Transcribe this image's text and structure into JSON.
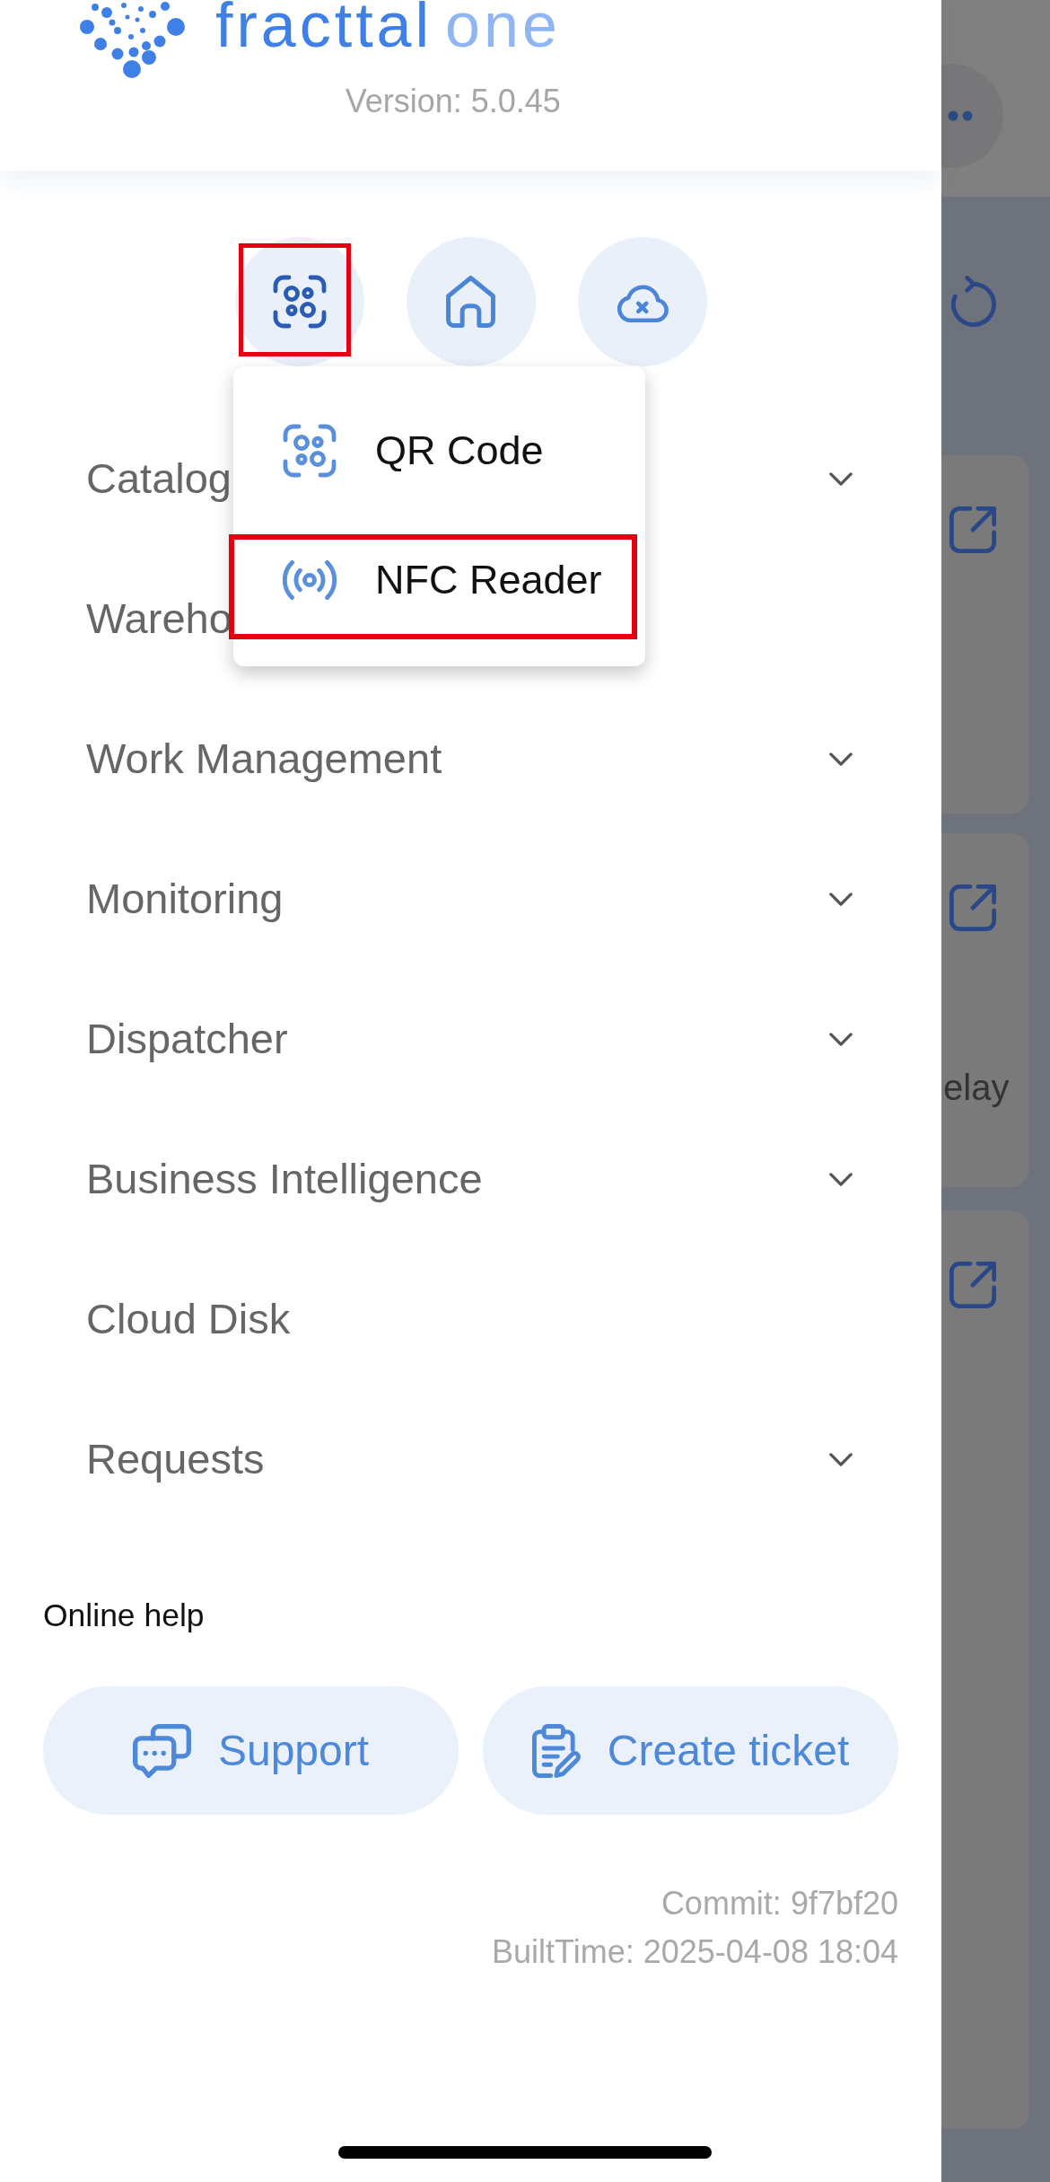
{
  "logo": {
    "name": "fracttal",
    "suffix": "one"
  },
  "version": "Version: 5.0.45",
  "quick_actions": [
    {
      "kind": "scan",
      "selected": true,
      "highlighted": true
    },
    {
      "kind": "home",
      "selected": false,
      "highlighted": false
    },
    {
      "kind": "cloud_off",
      "selected": false,
      "highlighted": false
    }
  ],
  "scan_menu": {
    "items": [
      {
        "kind": "qr",
        "label": "QR Code",
        "highlighted": false
      },
      {
        "kind": "nfc",
        "label": "NFC Reader",
        "highlighted": true
      }
    ]
  },
  "nav": [
    {
      "label": "Catalog",
      "kind": "group"
    },
    {
      "label": "Wareho",
      "kind": "link"
    },
    {
      "label": "Work Management",
      "kind": "group"
    },
    {
      "label": "Monitoring",
      "kind": "group"
    },
    {
      "label": "Dispatcher",
      "kind": "group"
    },
    {
      "label": "Business Intelligence",
      "kind": "group"
    },
    {
      "label": "Cloud Disk",
      "kind": "link"
    },
    {
      "label": "Requests",
      "kind": "group"
    }
  ],
  "help": {
    "title": "Online help",
    "buttons": [
      {
        "kind": "support",
        "label": "Support"
      },
      {
        "kind": "ticket",
        "label": "Create ticket"
      }
    ]
  },
  "build": {
    "commit": "Commit: 9f7bf20",
    "built_time": "BuiltTime: 2025-04-08 18:04"
  },
  "background": {
    "cards": [
      {
        "link": true
      },
      {
        "link": true,
        "caption": "elay"
      },
      {
        "link": true
      }
    ]
  }
}
